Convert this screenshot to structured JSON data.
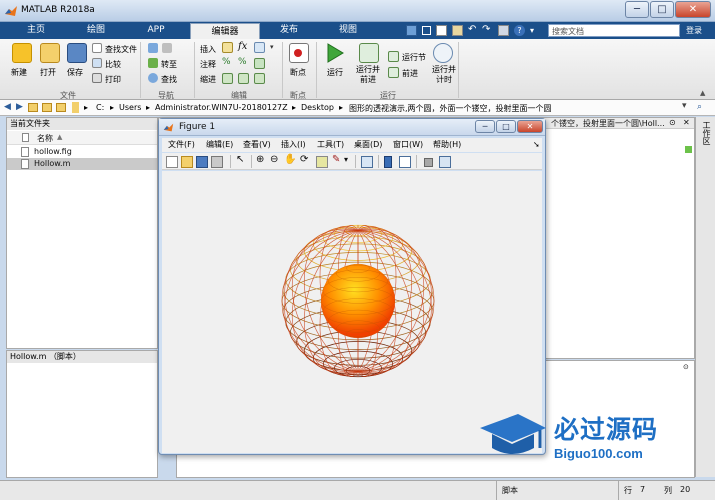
{
  "window": {
    "title": "MATLAB R2018a"
  },
  "tabs": [
    "主页",
    "绘图",
    "APP",
    "编辑器",
    "发布",
    "视图"
  ],
  "search": {
    "placeholder": "搜索文档",
    "login": "登录"
  },
  "ribbon": {
    "file": {
      "new": "新建",
      "open": "打开",
      "save": "保存",
      "find_file": "查找文件",
      "compare": "比较",
      "print": "打印",
      "group": "文件"
    },
    "nav": {
      "goto": "转至",
      "find": "查找",
      "group": "导航"
    },
    "edit": {
      "insert": "插入",
      "comment": "注释",
      "indent": "缩进",
      "group": "编辑"
    },
    "breakpoints": {
      "label": "断点",
      "group": "断点"
    },
    "run": {
      "run": "运行",
      "run_advance": "运行并\n前进",
      "run_section": "运行节",
      "advance": "前进",
      "run_time": "运行并\n计时",
      "group": "运行"
    }
  },
  "address": {
    "crumbs": [
      "C:",
      "Users",
      "Administrator.WIN7U-20180127Z",
      "Desktop",
      "图形的透视演示,两个圆，外面一个镂空，投射里面一个圆"
    ]
  },
  "file_panel": {
    "title": "当前文件夹",
    "column": "名称",
    "files": [
      "hollow.fig",
      "Hollow.m"
    ]
  },
  "details_panel": {
    "title": "Hollow.m （脚本）"
  },
  "editor": {
    "path": "个镂空，投射里面一个圆\\Holl..."
  },
  "workspace": {
    "title": "工作区"
  },
  "figure": {
    "title": "Figure 1",
    "menu": [
      "文件(F)",
      "编辑(E)",
      "查看(V)",
      "插入(I)",
      "工具(T)",
      "桌面(D)",
      "窗口(W)",
      "帮助(H)"
    ]
  },
  "watermark": {
    "name": "必过源码",
    "url": "Biguo100.com"
  },
  "status": {
    "type": "脚本",
    "row_label": "行",
    "row": "7",
    "col_label": "列",
    "col": "20"
  },
  "colors": {
    "tab_bar": "#1b4f8a",
    "accent": "#f0a020"
  }
}
